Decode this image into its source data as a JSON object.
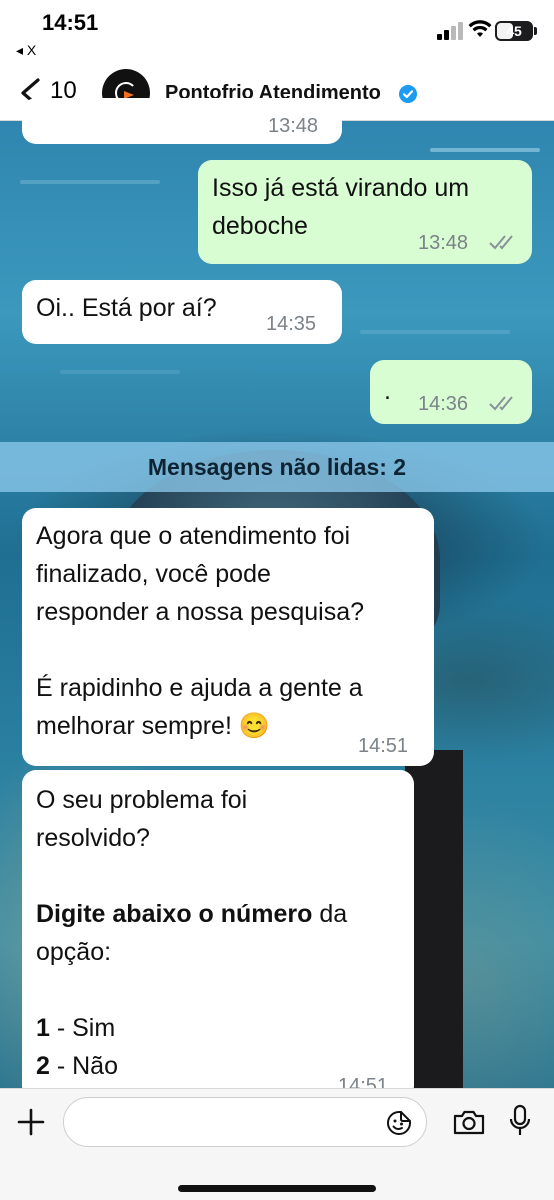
{
  "status_bar": {
    "time": "14:51",
    "back_app": "◂ X",
    "battery": "45"
  },
  "header": {
    "back_count": "10",
    "contact_name": "Pontofrio Atendimento"
  },
  "messages": [
    {
      "direction": "in",
      "text": "",
      "time": "13:48"
    },
    {
      "direction": "out",
      "text_line1": "Isso já está virando um",
      "text_line2": "deboche",
      "time": "13:48",
      "status": "read"
    },
    {
      "direction": "in",
      "text": "Oi.. Está por aí?",
      "time": "14:35"
    },
    {
      "direction": "out",
      "text": ".",
      "time": "14:36",
      "status": "read"
    }
  ],
  "unread_banner": "Mensagens não lidas: 2",
  "survey": {
    "line1": "Agora que o atendimento foi",
    "line2": "finalizado, você pode",
    "line3": "responder a nossa pesquisa?",
    "line4": "É rapidinho e ajuda a gente a",
    "line5": "melhorar sempre! 😊",
    "time": "14:51"
  },
  "question": {
    "line1": "O seu problema foi",
    "line2": "resolvido?",
    "instruction_bold": "Digite abaixo o número",
    "instruction_rest": " da",
    "instruction_line2": "opção:",
    "option1_num": "1",
    "option1_label": " - Sim",
    "option2_num": "2",
    "option2_label": " - Não",
    "time": "14:51"
  },
  "input": {
    "placeholder": ""
  }
}
